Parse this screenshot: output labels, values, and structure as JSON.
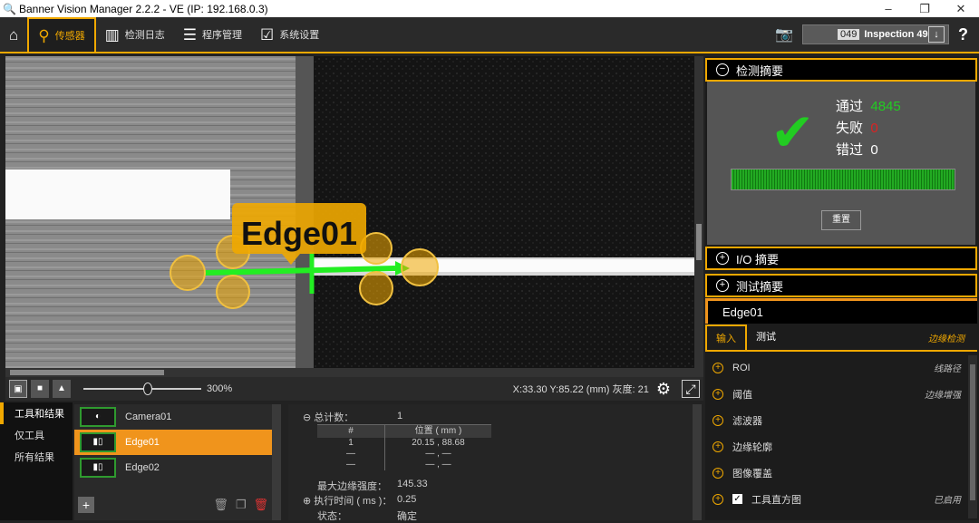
{
  "window": {
    "title": "Banner Vision Manager 2.2.2 - VE (IP: 192.168.0.3)",
    "min": "–",
    "max": "❐",
    "close": "✕"
  },
  "toolbar": {
    "home_icon": "home-icon",
    "tabs": [
      {
        "label": "传感器",
        "icon": "sensor-icon"
      },
      {
        "label": "检测日志",
        "icon": "log-icon"
      },
      {
        "label": "程序管理",
        "icon": "program-icon"
      },
      {
        "label": "系统设置",
        "icon": "settings-icon"
      }
    ],
    "inspection_num": "049",
    "inspection_name": "Inspection 49",
    "download_icon": "download-icon",
    "help": "?"
  },
  "viewer": {
    "label": "Edge01",
    "zoom": "300%",
    "coords": "X:33.30 Y:85.22 (mm) 灰度: 21"
  },
  "left_nav": [
    "工具和结果",
    "仅工具",
    "所有结果"
  ],
  "tools": [
    {
      "name": "Camera01",
      "icon": "camera-tool-icon"
    },
    {
      "name": "Edge01",
      "icon": "edge-tool-icon"
    },
    {
      "name": "Edge02",
      "icon": "edge-tool-icon"
    }
  ],
  "results": {
    "total_label": "总计数：",
    "total_value": "1",
    "col_num": "#",
    "col_pos": "位置 ( mm )",
    "rows": [
      {
        "num": "1",
        "pos": "20.15  ,  88.68"
      },
      {
        "num": "—",
        "pos": "—  ,  —"
      },
      {
        "num": "—",
        "pos": "—  ,  —"
      }
    ],
    "max_edge_label": "最大边缘强度：",
    "max_edge_value": "145.33",
    "exec_label": "执行时间 ( ms )：",
    "exec_value": "0.25",
    "status_label": "状态：",
    "status_value": "确定"
  },
  "summary": {
    "title": "检测摘要",
    "pass_label": "通过",
    "pass_value": "4845",
    "fail_label": "失败",
    "fail_value": "0",
    "error_label": "错过",
    "error_value": "0",
    "reset": "重置",
    "pass_ratio": 1.0
  },
  "io_summary": "I/O 摘要",
  "test_summary": "测试摘要",
  "tool_title": "Edge01",
  "props_tabs": [
    "输入",
    "测试"
  ],
  "props_mode": "边缘检测",
  "props": [
    {
      "label": "ROI",
      "value": "线路径"
    },
    {
      "label": "阈值",
      "value": "边缘增强"
    },
    {
      "label": "滤波器",
      "value": ""
    },
    {
      "label": "边缘轮廓",
      "value": ""
    },
    {
      "label": "图像覆盖",
      "value": ""
    },
    {
      "label": "工具直方图",
      "value": "已启用"
    }
  ],
  "colors": {
    "accent": "#f0a800",
    "pass": "#22cc22",
    "fail": "#dd2222",
    "selected": "#f0941c"
  }
}
